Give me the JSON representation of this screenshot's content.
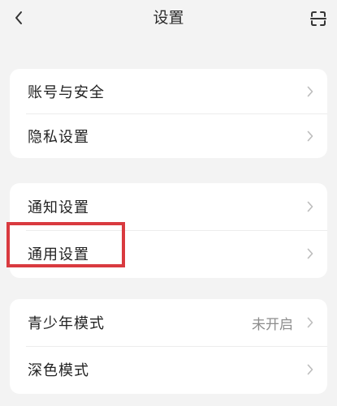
{
  "header": {
    "title": "设置",
    "back_icon": "chevron-left-icon",
    "scan_icon": "scan-icon"
  },
  "groups": [
    {
      "items": [
        {
          "label": "账号与安全"
        },
        {
          "label": "隐私设置"
        }
      ]
    },
    {
      "items": [
        {
          "label": "通知设置"
        },
        {
          "label": "通用设置"
        }
      ]
    },
    {
      "items": [
        {
          "label": "青少年模式",
          "value": "未开启"
        },
        {
          "label": "深色模式"
        }
      ]
    }
  ],
  "colors": {
    "background": "#f3f3f3",
    "card": "#ffffff",
    "highlight": "#d93a3f",
    "secondary_text": "#8d8d8d"
  }
}
